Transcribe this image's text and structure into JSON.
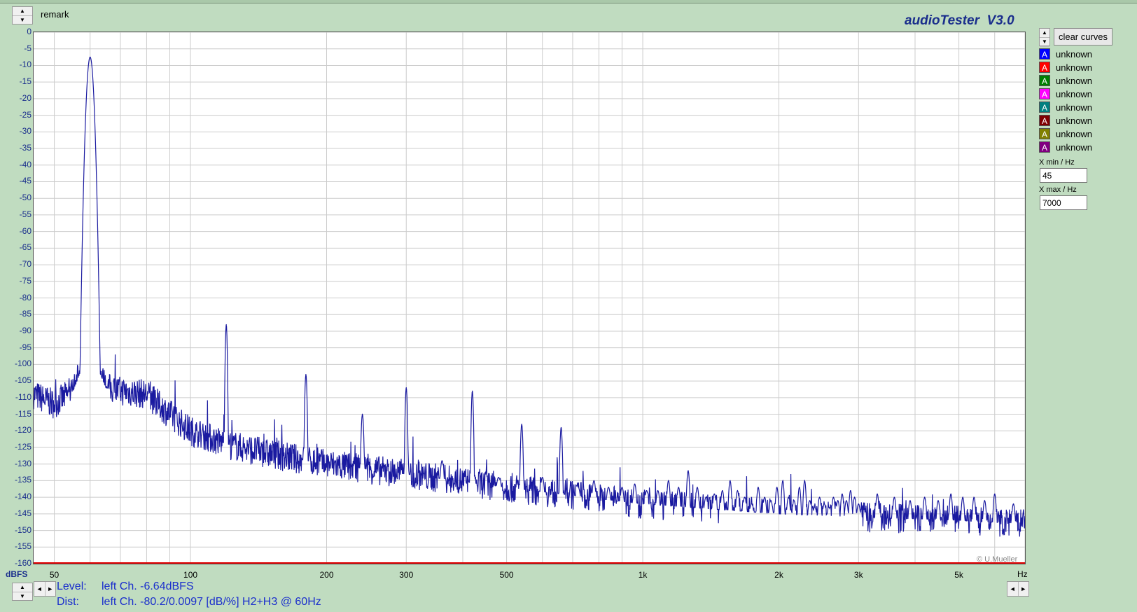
{
  "header": {
    "remark_label": "remark",
    "app_title": "audioTester  V3.0"
  },
  "controls": {
    "clear_label": "clear curves",
    "xmin_label": "X min / Hz",
    "xmin_value": "45",
    "xmax_label": "X max / Hz",
    "xmax_value": "7000"
  },
  "legend": [
    {
      "symbol": "A",
      "label": "unknown",
      "color": "#0000ff"
    },
    {
      "symbol": "A",
      "label": "unknown",
      "color": "#ff0000"
    },
    {
      "symbol": "A",
      "label": "unknown",
      "color": "#008000"
    },
    {
      "symbol": "A",
      "label": "unknown",
      "color": "#ff00ff"
    },
    {
      "symbol": "A",
      "label": "unknown",
      "color": "#008080"
    },
    {
      "symbol": "A",
      "label": "unknown",
      "color": "#800000"
    },
    {
      "symbol": "A",
      "label": "unknown",
      "color": "#808000"
    },
    {
      "symbol": "A",
      "label": "unknown",
      "color": "#800080"
    }
  ],
  "info": {
    "level_key": "Level:",
    "level_value": "left Ch. -6.64dBFS",
    "dist_key": "Dist:",
    "dist_value": "left Ch. -80.2/0.0097 [dB/%] H2+H3 @ 60Hz"
  },
  "copyright": "© U.Mueller",
  "chart_data": {
    "type": "line",
    "xscale": "log",
    "xlim": [
      45,
      7000
    ],
    "ylim": [
      -160,
      0
    ],
    "ylabel": "dBFS",
    "xlabel": "Hz",
    "grid": true,
    "yticks": [
      "0",
      "-5",
      "-10",
      "-15",
      "-20",
      "-25",
      "-30",
      "-35",
      "-40",
      "-45",
      "-50",
      "-55",
      "-60",
      "-65",
      "-70",
      "-75",
      "-80",
      "-85",
      "-90",
      "-95",
      "-100",
      "-105",
      "-110",
      "-115",
      "-120",
      "-125",
      "-130",
      "-135",
      "-140",
      "-145",
      "-150",
      "-155",
      "-160"
    ],
    "xticks": [
      {
        "value": 50,
        "label": "50"
      },
      {
        "value": 100,
        "label": "100"
      },
      {
        "value": 200,
        "label": "200"
      },
      {
        "value": 300,
        "label": "300"
      },
      {
        "value": 500,
        "label": "500"
      },
      {
        "value": 1000,
        "label": "1k"
      },
      {
        "value": 2000,
        "label": "2k"
      },
      {
        "value": 3000,
        "label": "3k"
      },
      {
        "value": 5000,
        "label": "5k"
      }
    ],
    "colors": {
      "trace": "#1a1aa0",
      "grid": "#cccccc",
      "baseline": "#e00000"
    },
    "series": [
      {
        "floor": [
          [
            45,
            -109
          ],
          [
            50,
            -112
          ],
          [
            55,
            -108
          ],
          [
            58,
            -100
          ],
          [
            60,
            -95
          ],
          [
            62,
            -100
          ],
          [
            65,
            -107
          ],
          [
            70,
            -108
          ],
          [
            80,
            -109
          ],
          [
            90,
            -115
          ],
          [
            100,
            -120
          ],
          [
            120,
            -124
          ],
          [
            150,
            -127
          ],
          [
            200,
            -130
          ],
          [
            300,
            -133
          ],
          [
            500,
            -137
          ],
          [
            1000,
            -142
          ],
          [
            2000,
            -145
          ],
          [
            3000,
            -146
          ],
          [
            5000,
            -147
          ],
          [
            7000,
            -148
          ]
        ],
        "peaks": [
          [
            60,
            -7.5
          ],
          [
            120,
            -88
          ],
          [
            180,
            -103
          ],
          [
            240,
            -115
          ],
          [
            300,
            -107
          ],
          [
            360,
            -129
          ],
          [
            420,
            -108
          ],
          [
            480,
            -134
          ],
          [
            540,
            -118
          ],
          [
            600,
            -134
          ],
          [
            660,
            -119
          ],
          [
            720,
            -137
          ],
          [
            780,
            -135
          ],
          [
            840,
            -137
          ],
          [
            900,
            -137
          ],
          [
            960,
            -136
          ],
          [
            1020,
            -138
          ],
          [
            1080,
            -138
          ],
          [
            1140,
            -135
          ],
          [
            1200,
            -137
          ],
          [
            1260,
            -132
          ],
          [
            1320,
            -137
          ],
          [
            1380,
            -140
          ],
          [
            1440,
            -139
          ],
          [
            1500,
            -138
          ],
          [
            1560,
            -135
          ],
          [
            1620,
            -138
          ],
          [
            1680,
            -140
          ],
          [
            1740,
            -142
          ],
          [
            1800,
            -137
          ],
          [
            1860,
            -140
          ],
          [
            1920,
            -141
          ],
          [
            1980,
            -137
          ],
          [
            2040,
            -135
          ],
          [
            2100,
            -140
          ],
          [
            2160,
            -141
          ],
          [
            2220,
            -137
          ],
          [
            2280,
            -135
          ],
          [
            2340,
            -141
          ],
          [
            2400,
            -143
          ],
          [
            2460,
            -140
          ],
          [
            2520,
            -142
          ],
          [
            2580,
            -143
          ],
          [
            2640,
            -140
          ],
          [
            2700,
            -141
          ],
          [
            2760,
            -139
          ],
          [
            2820,
            -141
          ],
          [
            2880,
            -138
          ],
          [
            2940,
            -140
          ],
          [
            3000,
            -142
          ],
          [
            3300,
            -139
          ],
          [
            3600,
            -140
          ],
          [
            3900,
            -141
          ],
          [
            4200,
            -140
          ],
          [
            4500,
            -141
          ],
          [
            4800,
            -139
          ],
          [
            5100,
            -140
          ],
          [
            5400,
            -140
          ],
          [
            5700,
            -141
          ],
          [
            6000,
            -139
          ],
          [
            6600,
            -142
          ]
        ]
      }
    ]
  }
}
